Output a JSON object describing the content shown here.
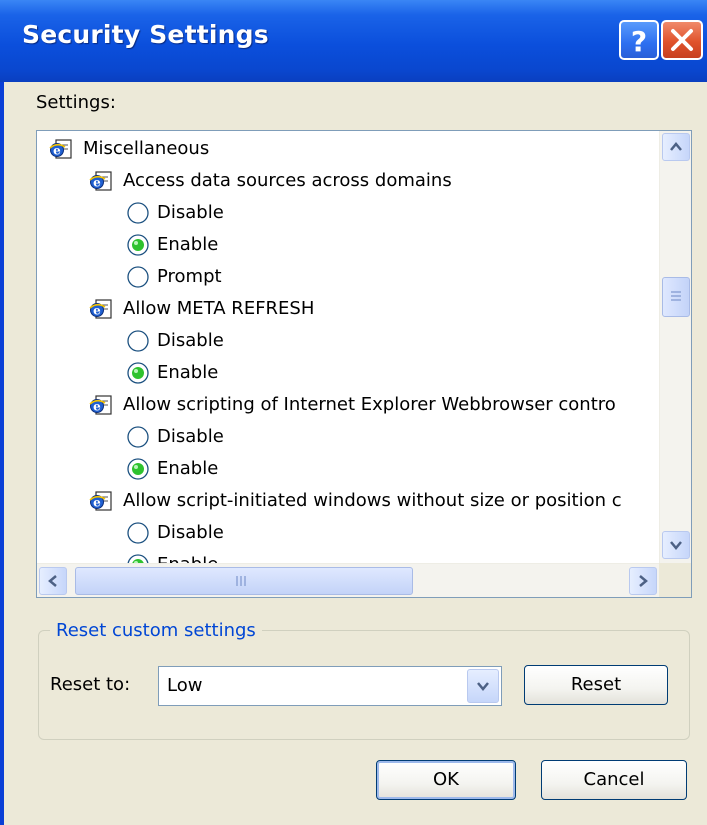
{
  "window": {
    "title": "Security Settings",
    "help_symbol": "?"
  },
  "settings_label": "Settings:",
  "tree": [
    {
      "type": "category",
      "label": "Miscellaneous",
      "icon": "ie-settings-icon"
    },
    {
      "type": "setting",
      "label": "Access data sources across domains",
      "icon": "ie-settings-icon"
    },
    {
      "type": "option",
      "label": "Disable",
      "selected": false
    },
    {
      "type": "option",
      "label": "Enable",
      "selected": true
    },
    {
      "type": "option",
      "label": "Prompt",
      "selected": false
    },
    {
      "type": "setting",
      "label": "Allow META REFRESH",
      "icon": "ie-settings-icon"
    },
    {
      "type": "option",
      "label": "Disable",
      "selected": false
    },
    {
      "type": "option",
      "label": "Enable",
      "selected": true
    },
    {
      "type": "setting",
      "label": "Allow scripting of Internet Explorer Webbrowser contro",
      "icon": "ie-settings-icon"
    },
    {
      "type": "option",
      "label": "Disable",
      "selected": false
    },
    {
      "type": "option",
      "label": "Enable",
      "selected": true
    },
    {
      "type": "setting",
      "label": "Allow script-initiated windows without size or position c",
      "icon": "ie-settings-icon"
    },
    {
      "type": "option",
      "label": "Disable",
      "selected": false
    },
    {
      "type": "option",
      "label": "Enable",
      "selected": true
    }
  ],
  "reset_group": {
    "title": "Reset custom settings",
    "reset_to_label": "Reset to:",
    "selected_level": "Low",
    "reset_button": "Reset"
  },
  "buttons": {
    "ok": "OK",
    "cancel": "Cancel"
  },
  "colors": {
    "titlebar": "#0b4fdc",
    "dialog_bg": "#ece9d8",
    "group_title": "#0046d5",
    "radio_selected": "#2ec22e",
    "close_button": "#e0532c"
  }
}
